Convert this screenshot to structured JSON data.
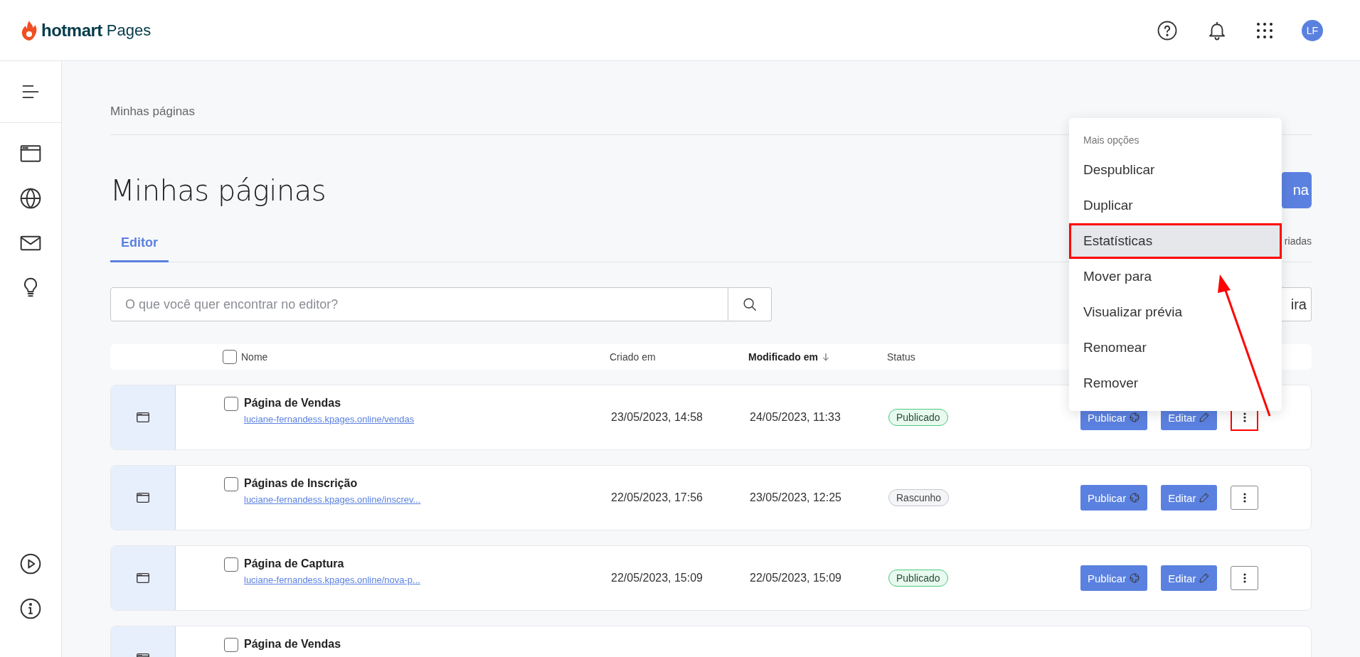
{
  "header": {
    "brand": "hotmart",
    "product": "Pages",
    "avatar": "LF"
  },
  "breadcrumb": "Minhas páginas",
  "title": "Minhas páginas",
  "title_button": "na",
  "tabs": [
    {
      "label": "Editor",
      "selected": true
    }
  ],
  "tabs_side_text": "riadas",
  "search": {
    "placeholder": "O que você quer encontrar no editor?"
  },
  "search_side_button": "ira",
  "table": {
    "header_checked": false,
    "columns": [
      {
        "label": "Nome",
        "sorted": false
      },
      {
        "label": "Criado em",
        "sorted": false
      },
      {
        "label": "Modificado em",
        "sorted": true
      },
      {
        "label": "Status",
        "sorted": false
      }
    ],
    "rows": [
      {
        "name": "Página de Vendas",
        "url": "luciane-fernandess.kpages.online/vendas",
        "created": "23/05/2023, 14:58",
        "modified": "24/05/2023, 11:33",
        "status": {
          "kind": "published",
          "label": "Publicado"
        },
        "checked": false,
        "publish": "Publicar",
        "edit": "Editar",
        "more_highlighted": true
      },
      {
        "name": "Páginas de Inscrição",
        "url": "luciane-fernandess.kpages.online/inscrev...",
        "created": "22/05/2023, 17:56",
        "modified": "23/05/2023, 12:25",
        "status": {
          "kind": "draft",
          "label": "Rascunho"
        },
        "checked": false,
        "publish": "Publicar",
        "edit": "Editar",
        "more_highlighted": false
      },
      {
        "name": "Página de Captura",
        "url": "luciane-fernandess.kpages.online/nova-p...",
        "created": "22/05/2023, 15:09",
        "modified": "22/05/2023, 15:09",
        "status": {
          "kind": "published",
          "label": "Publicado"
        },
        "checked": false,
        "publish": "Publicar",
        "edit": "Editar",
        "more_highlighted": false
      },
      {
        "name": "Página de Vendas",
        "checked": false
      }
    ]
  },
  "menu": {
    "title": "Mais opções",
    "items": [
      {
        "label": "Despublicar",
        "hovered": false,
        "highlighted": false
      },
      {
        "label": "Duplicar",
        "hovered": false,
        "highlighted": false
      },
      {
        "label": "Estatísticas",
        "hovered": true,
        "highlighted": true
      },
      {
        "label": "Mover para",
        "hovered": false,
        "highlighted": false
      },
      {
        "label": "Visualizar prévia",
        "hovered": false,
        "highlighted": false
      },
      {
        "label": "Renomear",
        "hovered": false,
        "highlighted": false
      },
      {
        "label": "Remover",
        "hovered": false,
        "highlighted": false
      }
    ]
  }
}
